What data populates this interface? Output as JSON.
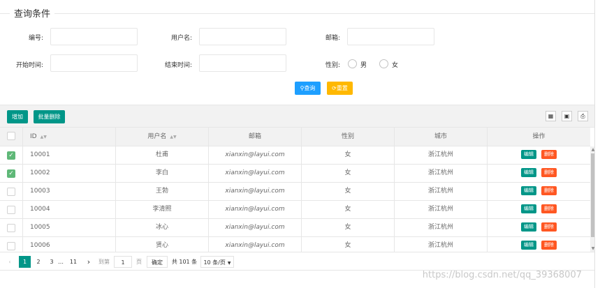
{
  "search": {
    "title": "查询条件",
    "fields": [
      {
        "label": "编号:",
        "value": ""
      },
      {
        "label": "用户名:",
        "value": ""
      },
      {
        "label": "邮箱:",
        "value": ""
      },
      {
        "label": "开始时间:",
        "value": ""
      },
      {
        "label": "结束时间:",
        "value": ""
      }
    ],
    "gender_label": "性别:",
    "gender_options": [
      "男",
      "女"
    ],
    "query_button": "查询",
    "reset_button": "重置"
  },
  "toolbar": {
    "add_button": "增加",
    "batch_delete_button": "批量删除",
    "icons": [
      "columns-icon",
      "export-icon",
      "print-icon"
    ]
  },
  "table": {
    "columns": [
      "ID",
      "用户名",
      "邮箱",
      "性别",
      "城市",
      "操作"
    ],
    "rows": [
      {
        "checked": true,
        "id": "10001",
        "username": "杜甫",
        "email": "xianxin@layui.com",
        "gender": "女",
        "city": "浙江杭州"
      },
      {
        "checked": true,
        "id": "10002",
        "username": "李白",
        "email": "xianxin@layui.com",
        "gender": "女",
        "city": "浙江杭州"
      },
      {
        "checked": false,
        "id": "10003",
        "username": "王勃",
        "email": "xianxin@layui.com",
        "gender": "女",
        "city": "浙江杭州"
      },
      {
        "checked": false,
        "id": "10004",
        "username": "李清照",
        "email": "xianxin@layui.com",
        "gender": "女",
        "city": "浙江杭州"
      },
      {
        "checked": false,
        "id": "10005",
        "username": "冰心",
        "email": "xianxin@layui.com",
        "gender": "女",
        "city": "浙江杭州"
      },
      {
        "checked": false,
        "id": "10006",
        "username": "贤心",
        "email": "xianxin@layui.com",
        "gender": "女",
        "city": "浙江杭州"
      }
    ],
    "edit_label": "编辑",
    "delete_label": "删除"
  },
  "pager": {
    "pages": [
      "1",
      "2",
      "3",
      "…",
      "11"
    ],
    "current": "1",
    "goto_prefix": "到第",
    "goto_value": "1",
    "goto_suffix": "页",
    "confirm": "确定",
    "total": "共 101 条",
    "per_page": "10 条/页"
  },
  "watermark": "https://blog.csdn.net/qq_39368007",
  "colors": {
    "primary": "#009688",
    "blue": "#1e9fff",
    "orange": "#ffb800",
    "danger": "#ff5722",
    "check": "#5fb878"
  }
}
